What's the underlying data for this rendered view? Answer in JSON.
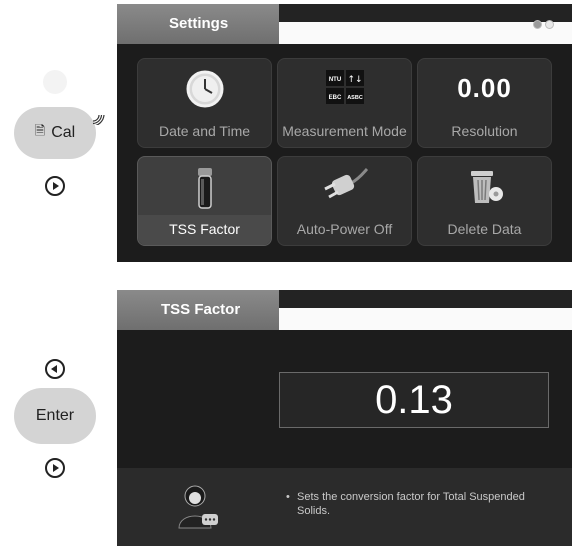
{
  "hardware_keys": {
    "cal_label": "Cal",
    "enter_label": "Enter"
  },
  "settings_screen": {
    "title": "Settings",
    "page_indicator": {
      "current": 1,
      "total": 2
    },
    "tiles": [
      {
        "label": "Date and Time",
        "icon": "clock-icon"
      },
      {
        "label": "Measurement Mode",
        "icon": "measurement-mode-icon",
        "icon_text": [
          "NTU",
          "↑↓",
          "EBC",
          "ASBC"
        ]
      },
      {
        "label": "Resolution",
        "value": "0.00"
      },
      {
        "label": "TSS Factor",
        "icon": "vial-icon",
        "selected": true
      },
      {
        "label": "Auto-Power Off",
        "icon": "power-plug-icon"
      },
      {
        "label": "Delete Data",
        "icon": "trash-can-icon"
      }
    ]
  },
  "tss_screen": {
    "title": "TSS Factor",
    "value": "0.13",
    "help_text": "Sets the conversion factor for Total Suspended Solids."
  }
}
